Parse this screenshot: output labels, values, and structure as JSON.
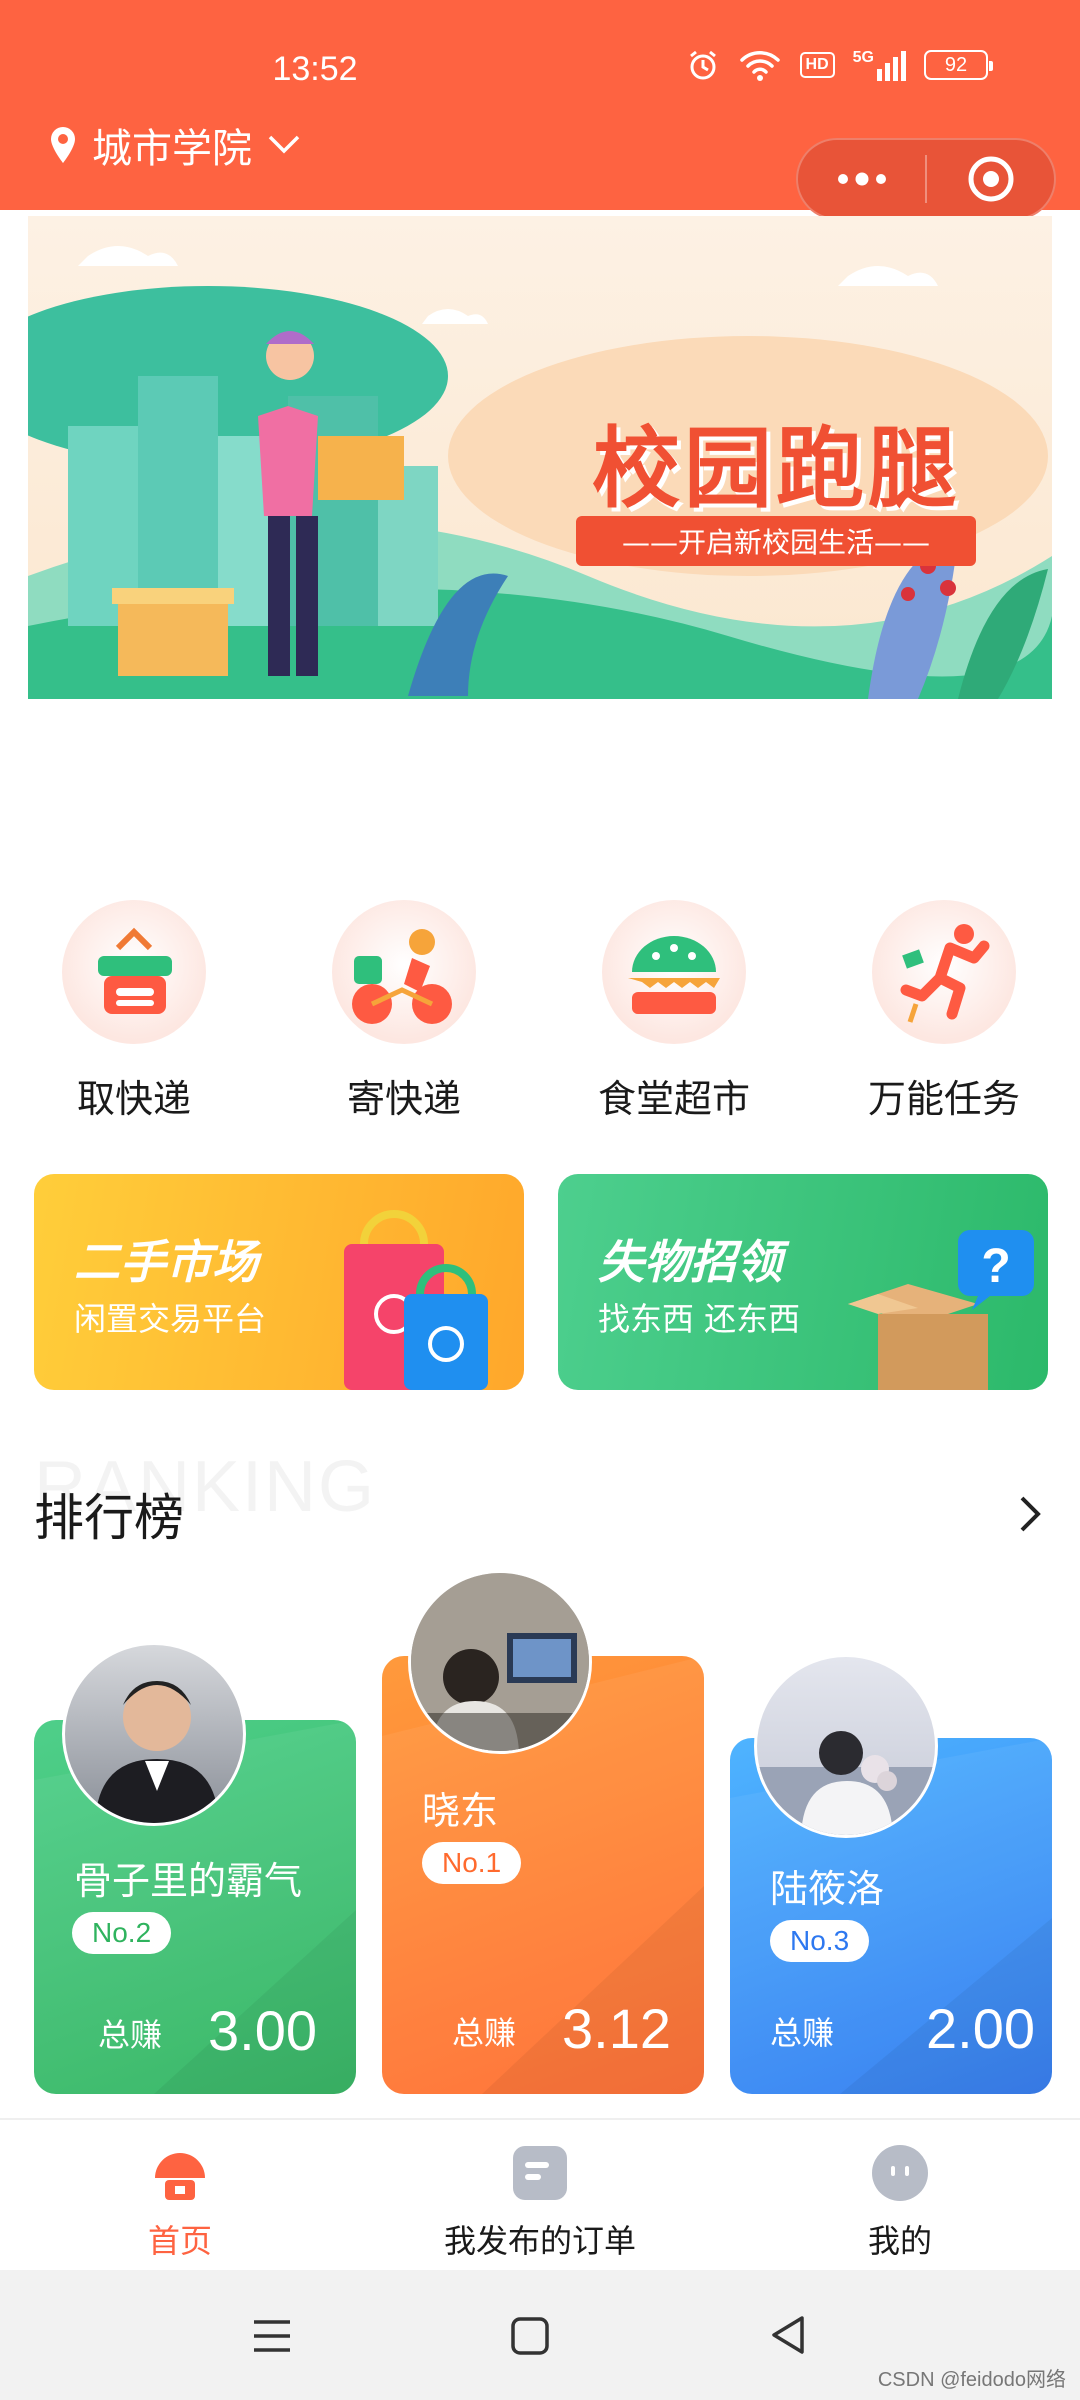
{
  "status_bar": {
    "time": "13:52",
    "hd_label": "HD",
    "network_label": "5G",
    "battery": "92"
  },
  "location": {
    "name": "城市学院"
  },
  "banner": {
    "title": "校园跑腿",
    "subtitle": "——开启新校园生活——"
  },
  "categories": [
    {
      "label": "取快递",
      "icon": "basket-icon"
    },
    {
      "label": "寄快递",
      "icon": "bicycle-courier-icon"
    },
    {
      "label": "食堂超市",
      "icon": "burger-icon"
    },
    {
      "label": "万能任务",
      "icon": "running-man-icon"
    }
  ],
  "promos": [
    {
      "title": "二手市场",
      "subtitle": "闲置交易平台"
    },
    {
      "title": "失物招领",
      "subtitle": "找东西 还东西"
    }
  ],
  "ranking": {
    "bg_text": "RANKING",
    "title": "排行榜",
    "earn_label": "总赚",
    "entries": [
      {
        "name": "骨子里的霸气",
        "rank": "No.2",
        "earned": "3.00"
      },
      {
        "name": "晓东",
        "rank": "No.1",
        "earned": "3.12"
      },
      {
        "name": "陆筱洛",
        "rank": "No.3",
        "earned": "2.00"
      }
    ]
  },
  "tabs": [
    {
      "label": "首页",
      "active": true
    },
    {
      "label": "我发布的订单",
      "active": false
    },
    {
      "label": "我的",
      "active": false
    }
  ],
  "watermark": "CSDN @feidodo网络",
  "colors": {
    "primary": "#fe6341",
    "green": "#3ec07a",
    "orange": "#ff7a3c",
    "blue": "#3d8cf5"
  }
}
